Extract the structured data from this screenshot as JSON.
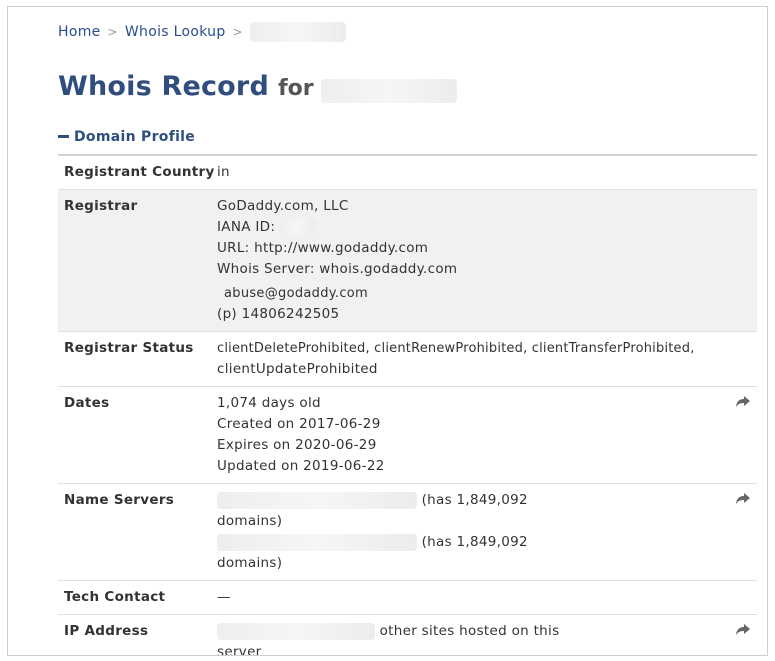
{
  "breadcrumb": {
    "home": "Home",
    "whois": "Whois Lookup",
    "sep": ">"
  },
  "title": {
    "main": "Whois Record",
    "for": "for"
  },
  "section": {
    "label": "Domain Profile"
  },
  "rows": {
    "registrant_country": {
      "label": "Registrant Country",
      "value": "in"
    },
    "registrar": {
      "label": "Registrar",
      "name": "GoDaddy.com, LLC",
      "iana": "IANA ID:",
      "url": "URL: http://www.godaddy.com",
      "whois_server": "Whois Server: whois.godaddy.com",
      "email": "abuse@godaddy.com",
      "phone_prefix": "(p)",
      "phone": "14806242505"
    },
    "registrar_status": {
      "label": "Registrar Status",
      "line1": "clientDeleteProhibited, clientRenewProhibited, clientTransferProhibited,",
      "line2": "clientUpdateProhibited"
    },
    "dates": {
      "label": "Dates",
      "age": "1,074 days old",
      "created": "Created on 2017-06-29",
      "expires": "Expires on 2020-06-29",
      "updated": "Updated on 2019-06-22"
    },
    "name_servers": {
      "label": "Name Servers",
      "ns1_count": "(has 1,849,092",
      "ns1_tail": "domains)",
      "ns2_count": "(has 1,849,092",
      "ns2_tail": "domains)"
    },
    "tech_contact": {
      "label": "Tech Contact",
      "value": "—"
    },
    "ip_address": {
      "label": "IP Address",
      "text": "other sites hosted on this",
      "tail": "server"
    }
  },
  "icons": {
    "share": "share-arrow-icon",
    "collapse": "minus-icon"
  },
  "colors": {
    "link": "#2a4d8f",
    "heading": "#2f4e7e",
    "alt_row": "#f1f1f1"
  }
}
